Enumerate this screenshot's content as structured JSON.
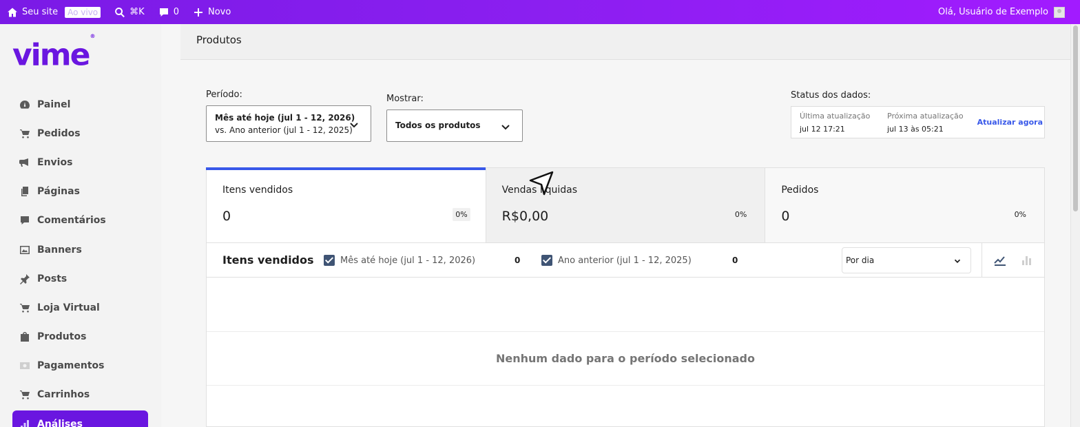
{
  "adminbar": {
    "site_label": "Seu site",
    "live_badge": "Ao vivo",
    "search_shortcut": "⌘K",
    "comments_count": "0",
    "new_label": "Novo",
    "greeting": "Olá, Usuário de Exemplo"
  },
  "brand": {
    "logo_text": "vime",
    "logo_mark": "®",
    "accent": "#6a16e0"
  },
  "sidebar": {
    "items": [
      {
        "label": "Painel",
        "icon": "gauge-icon"
      },
      {
        "label": "Pedidos",
        "icon": "cart-icon"
      },
      {
        "label": "Envios",
        "icon": "megaphone-icon"
      },
      {
        "label": "Páginas",
        "icon": "pages-icon"
      },
      {
        "label": "Comentários",
        "icon": "comment-icon"
      },
      {
        "label": "Banners",
        "icon": "image-icon"
      },
      {
        "label": "Posts",
        "icon": "pin-icon"
      },
      {
        "label": "Loja Virtual",
        "icon": "cart-icon"
      },
      {
        "label": "Produtos",
        "icon": "bag-icon"
      },
      {
        "label": "Pagamentos",
        "icon": "money-icon"
      },
      {
        "label": "Carrinhos",
        "icon": "cart-icon"
      },
      {
        "label": "Análises",
        "icon": "bar-chart-icon",
        "active": true
      }
    ]
  },
  "header": {
    "title": "Produtos"
  },
  "filters": {
    "period_label": "Período:",
    "period_value_line1": "Mês até hoje (jul 1 - 12, 2026)",
    "period_value_line2": "vs. Ano anterior (jul 1 - 12, 2025)",
    "show_label": "Mostrar:",
    "show_value": "Todos os produtos"
  },
  "data_status": {
    "label": "Status dos dados:",
    "last_update_label": "Última atualização",
    "last_update_value": "jul 12 17:21",
    "next_update_label": "Próxima atualização",
    "next_update_value": "jul 13 às 05:21",
    "refresh_link": "Atualizar agora"
  },
  "kpis": [
    {
      "label": "Itens vendidos",
      "value": "0",
      "delta": "0%",
      "state": "selected"
    },
    {
      "label": "Vendas líquidas",
      "value": "R$0,00",
      "delta": "0%",
      "state": "hover"
    },
    {
      "label": "Pedidos",
      "value": "0",
      "delta": "0%",
      "state": "dim"
    }
  ],
  "chart": {
    "title": "Itens vendidos",
    "legend": [
      {
        "label": "Mês até hoje (jul 1 - 12, 2026)",
        "value": "0"
      },
      {
        "label": "Ano anterior (jul 1 - 12, 2025)",
        "value": "0"
      }
    ],
    "interval": "Por dia",
    "empty_message": "Nenhum dado para o período selecionado",
    "checkbox_color": "#3f5474",
    "selected_color": "#3858e9"
  }
}
